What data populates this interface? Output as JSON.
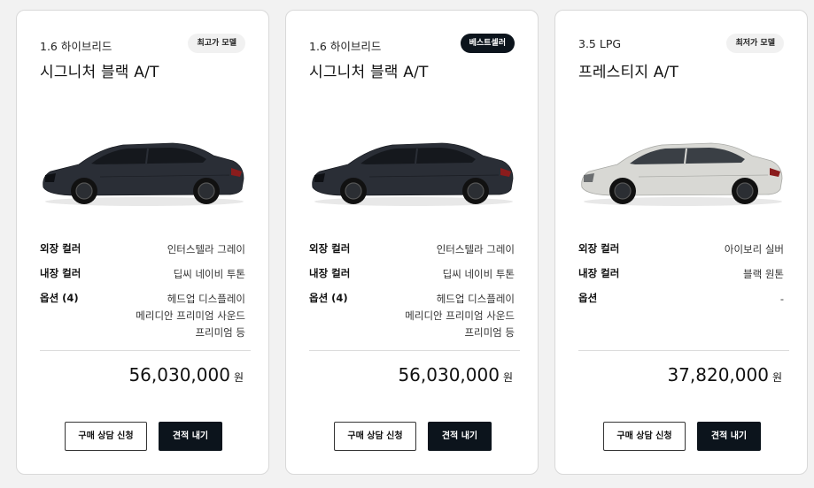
{
  "cards": [
    {
      "engine": "1.6 하이브리드",
      "badge": "최고가 모델",
      "trim": "시그니처 블랙 A/T",
      "car_color": "#2a2e36",
      "specs": {
        "exterior_label": "외장 컬러",
        "exterior_value": "인터스텔라 그레이",
        "interior_label": "내장 컬러",
        "interior_value": "딥씨 네이비 투톤",
        "options_label": "옵션 (4)",
        "options_lines": [
          "헤드업 디스플레이",
          "메리디안 프리미엄 사운드",
          "프리미엄 등"
        ]
      },
      "price": "56,030,000",
      "price_unit": "원",
      "consult_label": "구매 상담 신청",
      "estimate_label": "견적 내기"
    },
    {
      "engine": "1.6 하이브리드",
      "badge": "베스트셀러",
      "trim": "시그니처 블랙 A/T",
      "car_color": "#2a2e36",
      "specs": {
        "exterior_label": "외장 컬러",
        "exterior_value": "인터스텔라 그레이",
        "interior_label": "내장 컬러",
        "interior_value": "딥씨 네이비 투톤",
        "options_label": "옵션 (4)",
        "options_lines": [
          "헤드업 디스플레이",
          "메리디안 프리미엄 사운드",
          "프리미엄 등"
        ]
      },
      "price": "56,030,000",
      "price_unit": "원",
      "consult_label": "구매 상담 신청",
      "estimate_label": "견적 내기"
    },
    {
      "engine": "3.5 LPG",
      "badge": "최저가 모델",
      "trim": "프레스티지 A/T",
      "car_color": "#d8d8d4",
      "specs": {
        "exterior_label": "외장 컬러",
        "exterior_value": "아이보리 실버",
        "interior_label": "내장 컬러",
        "interior_value": "블랙 원톤",
        "options_label": "옵션",
        "options_lines": [
          "-"
        ]
      },
      "price": "37,820,000",
      "price_unit": "원",
      "consult_label": "구매 상담 신청",
      "estimate_label": "견적 내기"
    }
  ],
  "colors": {
    "badge_dark": "#0c141c",
    "button_dark": "#0c141c"
  }
}
